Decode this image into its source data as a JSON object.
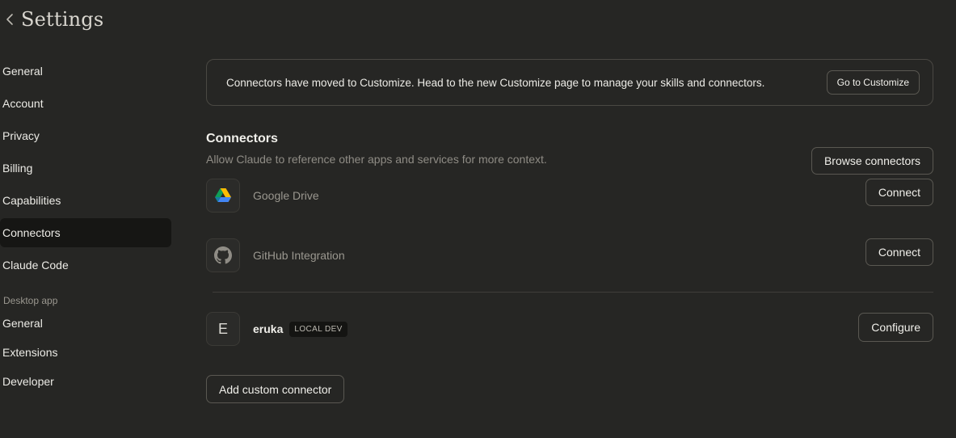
{
  "header": {
    "title": "Settings"
  },
  "sidebar": {
    "items": [
      {
        "label": "General"
      },
      {
        "label": "Account"
      },
      {
        "label": "Privacy"
      },
      {
        "label": "Billing"
      },
      {
        "label": "Capabilities"
      },
      {
        "label": "Connectors",
        "active": true
      },
      {
        "label": "Claude Code"
      }
    ],
    "desktop_section_label": "Desktop app",
    "desktop_items": [
      {
        "label": "General"
      },
      {
        "label": "Extensions"
      },
      {
        "label": "Developer"
      }
    ]
  },
  "banner": {
    "text": "Connectors have moved to Customize. Head to the new Customize page to manage your skills and connectors.",
    "button_label": "Go to Customize"
  },
  "connectors": {
    "title": "Connectors",
    "description": "Allow Claude to reference other apps and services for more context.",
    "browse_label": "Browse connectors",
    "list": [
      {
        "name": "Google Drive",
        "icon": "google-drive-icon",
        "action_label": "Connect"
      },
      {
        "name": "GitHub Integration",
        "icon": "github-icon",
        "action_label": "Connect"
      }
    ],
    "custom": {
      "icon_letter": "E",
      "name": "eruka",
      "badge": "LOCAL DEV",
      "action_label": "Configure"
    },
    "add_custom_label": "Add custom connector"
  }
}
